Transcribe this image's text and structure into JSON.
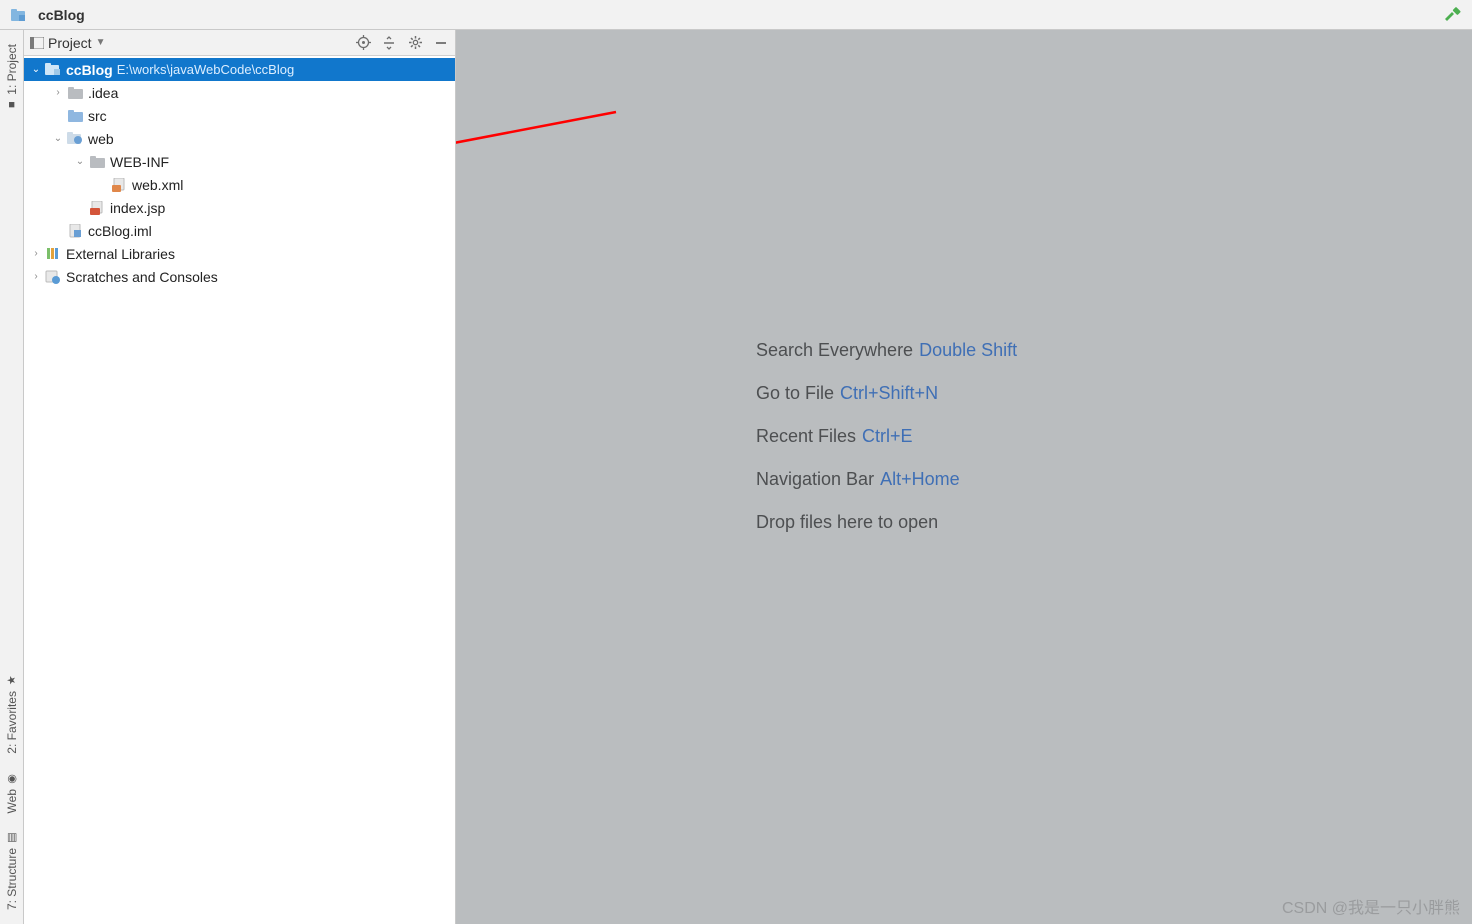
{
  "navbar": {
    "title": "ccBlog"
  },
  "gutter": {
    "project": "1: Project",
    "favorites": "2: Favorites",
    "web": "Web",
    "structure": "7: Structure"
  },
  "panel": {
    "title": "Project",
    "tools": {
      "target": "target",
      "collapse": "collapse",
      "settings": "settings",
      "hide": "hide"
    }
  },
  "tree": {
    "root": {
      "name": "ccBlog",
      "path": "E:\\works\\javaWebCode\\ccBlog"
    },
    "idea": ".idea",
    "src": "src",
    "web": "web",
    "webinf": "WEB-INF",
    "webxml": "web.xml",
    "indexjsp": "index.jsp",
    "iml": "ccBlog.iml",
    "extlib": "External Libraries",
    "scratches": "Scratches and Consoles"
  },
  "hints": {
    "search": {
      "label": "Search Everywhere",
      "shortcut": "Double Shift"
    },
    "gotofile": {
      "label": "Go to File",
      "shortcut": "Ctrl+Shift+N"
    },
    "recent": {
      "label": "Recent Files",
      "shortcut": "Ctrl+E"
    },
    "navbar": {
      "label": "Navigation Bar",
      "shortcut": "Alt+Home"
    },
    "drop": {
      "label": "Drop files here to open"
    }
  },
  "watermark": "CSDN @我是一只小胖熊"
}
